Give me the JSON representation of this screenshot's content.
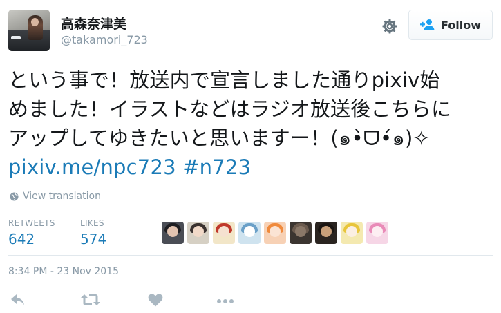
{
  "user": {
    "display_name": "高森奈津美",
    "handle": "@takamori_723"
  },
  "header": {
    "settings_icon": "gear-icon",
    "follow_label": "Follow"
  },
  "tweet": {
    "line1": "という事で！放送内で宣言しました通りpixiv始",
    "line2": "めました！イラストなどはラジオ放送後こちらに",
    "line3": "アップしてゆきたいと思いますー！(๑•̀ᗜ•́๑)✧",
    "link": "pixiv.me/npc723",
    "hashtag": "#n723",
    "translate_label": "View translation"
  },
  "stats": {
    "retweets_label": "RETWEETS",
    "retweets_value": "642",
    "likes_label": "LIKES",
    "likes_value": "574"
  },
  "likers": [
    {
      "name": "liker-1",
      "bg": "#4a4d55",
      "hair": "#1e1e22",
      "face": "#e2c3b0"
    },
    {
      "name": "liker-2",
      "bg": "#d6d0c4",
      "hair": "#3a3230",
      "face": "#f1d9c8"
    },
    {
      "name": "liker-3",
      "bg": "#f2e6c8",
      "hair": "#c0392b",
      "face": "#f5e1d0"
    },
    {
      "name": "liker-4",
      "bg": "#cfe3ef",
      "hair": "#6aa0c8",
      "face": "#ffffff"
    },
    {
      "name": "liker-5",
      "bg": "#f7d1b5",
      "hair": "#f08a3c",
      "face": "#fbe4d4"
    },
    {
      "name": "liker-6",
      "bg": "#3b3530",
      "hair": "#6b5b4e",
      "face": "#8a7868"
    },
    {
      "name": "liker-7",
      "bg": "#2a2420",
      "hair": "#1a1512",
      "face": "#c9a07a"
    },
    {
      "name": "liker-8",
      "bg": "#f4e9b0",
      "hair": "#e8c53a",
      "face": "#fbefe2"
    },
    {
      "name": "liker-9",
      "bg": "#f6d6e6",
      "hair": "#e98bb8",
      "face": "#fdeef2"
    }
  ],
  "timestamp": "8:34 PM - 23 Nov 2015",
  "actions": [
    "reply-icon",
    "retweet-icon",
    "like-icon",
    "more-icon"
  ],
  "colors": {
    "link": "#1b7bb7",
    "muted": "#8899a6",
    "text": "#14171a",
    "follow_icon": "#1da1f2"
  }
}
